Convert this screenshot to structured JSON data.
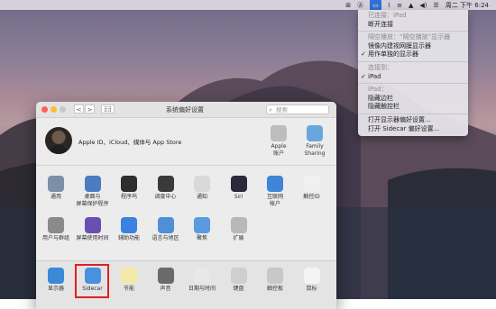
{
  "menubar": {
    "items": [
      "⊞",
      "Ⓐ",
      "▭",
      "⌇",
      "≡",
      "▲",
      "◀)",
      "☰"
    ],
    "clock": "周二 下午 6:24"
  },
  "display_menu": {
    "rows": [
      {
        "label": "已连接：iPad",
        "disabled": true,
        "checked": false
      },
      {
        "label": "断开连接",
        "disabled": false,
        "checked": false
      },
      {
        "sep": true
      },
      {
        "label": "隔空播放：“隔空播放”显示器",
        "disabled": true,
        "checked": false
      },
      {
        "label": "镜像内建视网膜显示器",
        "disabled": false,
        "checked": false
      },
      {
        "label": "用作单独的显示器",
        "disabled": false,
        "checked": true
      },
      {
        "sep": true
      },
      {
        "label": "连接到：",
        "disabled": true,
        "checked": false
      },
      {
        "label": "iPad",
        "disabled": false,
        "checked": true
      },
      {
        "sep": true
      },
      {
        "label": "iPad：",
        "disabled": true,
        "checked": false
      },
      {
        "label": "隐藏边栏",
        "disabled": false,
        "checked": false
      },
      {
        "label": "隐藏触控栏",
        "disabled": false,
        "checked": false
      },
      {
        "sep": true
      },
      {
        "label": "打开显示器偏好设置...",
        "disabled": false,
        "checked": false
      },
      {
        "label": "打开 Sidecar 偏好设置...",
        "disabled": false,
        "checked": false
      }
    ]
  },
  "window": {
    "title": "系统偏好设置",
    "search_placeholder": "搜索",
    "back": "<",
    "forward": ">",
    "grid": "⣿⣿"
  },
  "account": {
    "text": "Apple ID、iCloud、媒体与 App Store",
    "right_tiles": [
      {
        "label": "Apple\n账户",
        "icon": "apple-icon",
        "color": "#bdbdbd"
      },
      {
        "label": "Family\nSharing",
        "icon": "family-sharing-icon",
        "color": "#6aa6de"
      }
    ]
  },
  "prefs_row1": [
    {
      "label": "通用",
      "icon": "general-icon",
      "color": "#7d8fa8"
    },
    {
      "label": "桌面与\n屏幕保护程序",
      "icon": "desktop-icon",
      "color": "#4c7cc0"
    },
    {
      "label": "程序坞",
      "icon": "dock-icon",
      "color": "#2d2d2d"
    },
    {
      "label": "调度中心",
      "icon": "mission-control-icon",
      "color": "#3a3a3a"
    },
    {
      "label": "通知",
      "icon": "notifications-icon",
      "color": "#d9d9d9"
    },
    {
      "label": "Siri",
      "icon": "siri-icon",
      "color": "#2a2a3a"
    },
    {
      "label": "互联网\n帐户",
      "icon": "internet-accounts-icon",
      "color": "#3f85d8"
    },
    {
      "label": "触控ID",
      "icon": "touch-id-icon",
      "color": "#f0f0f0"
    }
  ],
  "prefs_row2": [
    {
      "label": "用户与群组",
      "icon": "users-groups-icon",
      "color": "#8a8a8a"
    },
    {
      "label": "屏幕使用时间",
      "icon": "screen-time-icon",
      "color": "#6b4fb0"
    },
    {
      "label": "辅助功能",
      "icon": "accessibility-icon",
      "color": "#3b82e0"
    },
    {
      "label": "语言与地区",
      "icon": "language-region-icon",
      "color": "#4f8fd8"
    },
    {
      "label": "聚焦",
      "icon": "spotlight-icon",
      "color": "#5a9ae0"
    },
    {
      "label": "扩展",
      "icon": "extensions-icon",
      "color": "#b8b8b8"
    }
  ],
  "prefs_row3": [
    {
      "label": "显示器",
      "icon": "displays-icon",
      "color": "#3a8ad8"
    },
    {
      "label": "Sidecar",
      "icon": "sidecar-icon",
      "color": "#4a90e0"
    },
    {
      "label": "节能",
      "icon": "energy-saver-icon",
      "color": "#f2e9a8"
    },
    {
      "label": "声音",
      "icon": "sound-icon",
      "color": "#6a6a6a"
    },
    {
      "label": "日期与时间",
      "icon": "date-time-icon",
      "color": "#e8e8e8"
    },
    {
      "label": "键盘",
      "icon": "keyboard-icon",
      "color": "#cfcfcf"
    },
    {
      "label": "触控板",
      "icon": "trackpad-icon",
      "color": "#c8c8c8"
    },
    {
      "label": "鼠标",
      "icon": "mouse-icon",
      "color": "#f4f4f4"
    }
  ]
}
